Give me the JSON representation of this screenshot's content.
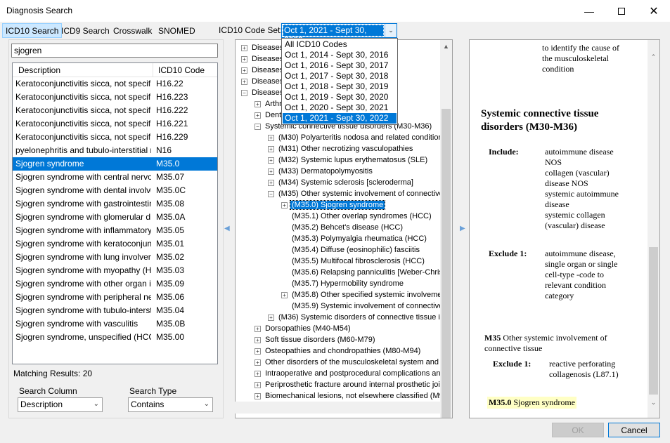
{
  "window": {
    "title": "Diagnosis Search"
  },
  "tabs": [
    "ICD10 Search",
    "ICD9 Search",
    "Crosswalk",
    "SNOMED"
  ],
  "codeset": {
    "label": "ICD10 Code Set:",
    "selected": "Oct 1, 2021 - Sept 30, 2022",
    "options": [
      "All ICD10 Codes",
      "Oct 1, 2014 - Sept 30, 2016",
      "Oct 1, 2016 - Sept 30, 2017",
      "Oct 1, 2017 - Sept 30, 2018",
      "Oct 1, 2018 - Sept 30, 2019",
      "Oct 1, 2019 - Sept 30, 2020",
      "Oct 1, 2020 - Sept 30, 2021",
      "Oct 1, 2021 - Sept 30, 2022"
    ]
  },
  "search": {
    "value": "sjogren"
  },
  "results": {
    "columns": [
      "Description",
      "ICD10 Code"
    ],
    "rows": [
      [
        "Keratoconjunctivitis sicca, not specifie...",
        "H16.22"
      ],
      [
        "Keratoconjunctivitis sicca, not specifie...",
        "H16.223"
      ],
      [
        "Keratoconjunctivitis sicca, not specifie...",
        "H16.222"
      ],
      [
        "Keratoconjunctivitis sicca, not specifie...",
        "H16.221"
      ],
      [
        "Keratoconjunctivitis sicca, not specifie...",
        "H16.229"
      ],
      [
        "pyelonephritis and tubulo-interstitial nep...",
        "N16"
      ],
      [
        "Sjogren syndrome",
        "M35.0"
      ],
      [
        "Sjogren syndrome with central nervous ...",
        "M35.07"
      ],
      [
        "Sjogren syndrome with dental involveme...",
        "M35.0C"
      ],
      [
        "Sjogren syndrome with gastrointestinal i...",
        "M35.08"
      ],
      [
        "Sjogren syndrome with glomerular disea...",
        "M35.0A"
      ],
      [
        "Sjogren syndrome with inflammatory art...",
        "M35.05"
      ],
      [
        "Sjogren syndrome with keratoconjuncti...",
        "M35.01"
      ],
      [
        "Sjogren syndrome with lung involveme...",
        "M35.02"
      ],
      [
        "Sjogren syndrome with myopathy (HCC)",
        "M35.03"
      ],
      [
        "Sjogren syndrome with other organ inv...",
        "M35.09"
      ],
      [
        "Sjogren syndrome with peripheral nervo...",
        "M35.06"
      ],
      [
        "Sjogren syndrome with tubulo-interstiti...",
        "M35.04"
      ],
      [
        "Sjogren syndrome with vasculitis",
        "M35.0B"
      ],
      [
        "Sjogren syndrome, unspecified (HCC)",
        "M35.00"
      ]
    ],
    "selected_index": 6,
    "matching_label": "Matching Results: 20"
  },
  "search_column": {
    "label": "Search Column",
    "value": "Description"
  },
  "search_type": {
    "label": "Search Type",
    "value": "Contains"
  },
  "tree": [
    {
      "text": "Diseases",
      "level": 0,
      "exp": "+"
    },
    {
      "text": "Diseases",
      "level": 0,
      "exp": "+"
    },
    {
      "text": "Diseases",
      "level": 0,
      "exp": "+"
    },
    {
      "text": "Diseases                                                    ue (L00-L99)",
      "level": 0,
      "exp": "+"
    },
    {
      "text": "Diseases                                                    connective t",
      "level": 0,
      "exp": "-"
    },
    {
      "text": "Arthr",
      "level": 1,
      "exp": "+"
    },
    {
      "text": "Dent                                              lusion] and ot",
      "level": 1,
      "exp": "+"
    },
    {
      "text": "Systemic connective tissue disorders (M30-M36)",
      "level": 1,
      "exp": "-"
    },
    {
      "text": "(M30) Polyarteritis nodosa and related conditions",
      "level": 2,
      "exp": "+"
    },
    {
      "text": "(M31) Other necrotizing vasculopathies",
      "level": 2,
      "exp": "+"
    },
    {
      "text": "(M32) Systemic lupus erythematosus (SLE)",
      "level": 2,
      "exp": "+"
    },
    {
      "text": "(M33) Dermatopolymyositis",
      "level": 2,
      "exp": "+"
    },
    {
      "text": "(M34) Systemic sclerosis [scleroderma]",
      "level": 2,
      "exp": "+"
    },
    {
      "text": "(M35) Other systemic involvement of connective t",
      "level": 2,
      "exp": "-"
    },
    {
      "text": "(M35.0) Sjogren syndrome",
      "level": 3,
      "exp": "+",
      "sel": true
    },
    {
      "text": "(M35.1) Other overlap syndromes (HCC)",
      "level": 3,
      "exp": ""
    },
    {
      "text": "(M35.2) Behcet's disease (HCC)",
      "level": 3,
      "exp": ""
    },
    {
      "text": "(M35.3) Polymyalgia rheumatica (HCC)",
      "level": 3,
      "exp": ""
    },
    {
      "text": "(M35.4) Diffuse (eosinophilic) fasciitis",
      "level": 3,
      "exp": ""
    },
    {
      "text": "(M35.5) Multifocal fibrosclerosis (HCC)",
      "level": 3,
      "exp": ""
    },
    {
      "text": "(M35.6) Relapsing panniculitis [Weber-Christia",
      "level": 3,
      "exp": ""
    },
    {
      "text": "(M35.7) Hypermobility syndrome",
      "level": 3,
      "exp": ""
    },
    {
      "text": "(M35.8) Other specified systemic involvement",
      "level": 3,
      "exp": "+"
    },
    {
      "text": "(M35.9) Systemic involvement of connective",
      "level": 3,
      "exp": ""
    },
    {
      "text": "(M36) Systemic disorders of connective tissue in d",
      "level": 2,
      "exp": "+"
    },
    {
      "text": "Dorsopathies (M40-M54)",
      "level": 1,
      "exp": "+"
    },
    {
      "text": "Soft tissue disorders (M60-M79)",
      "level": 1,
      "exp": "+"
    },
    {
      "text": "Osteopathies and chondropathies (M80-M94)",
      "level": 1,
      "exp": "+"
    },
    {
      "text": "Other disorders of the musculoskeletal system and co",
      "level": 1,
      "exp": "+"
    },
    {
      "text": "Intraoperative and postprocedural complications and",
      "level": 1,
      "exp": "+"
    },
    {
      "text": "Periprosthetic fracture around internal prosthetic joint",
      "level": 1,
      "exp": "+"
    },
    {
      "text": "Biomechanical lesions, not elsewhere classified (M99",
      "level": 1,
      "exp": "+"
    }
  ],
  "detail": {
    "top_lines": [
      "to identify the cause of",
      "the musculoskeletal",
      "condition"
    ],
    "section_title_1": "Systemic connective tissue",
    "section_title_2": "disorders (M30-M36)",
    "include_label": "Include:",
    "include_lines": [
      "autoimmune disease",
      "NOS",
      "collagen (vascular)",
      "disease NOS",
      "systemic autoimmune",
      "disease",
      "systemic collagen",
      "(vascular) disease"
    ],
    "exclude1_label": "Exclude 1:",
    "exclude1_lines": [
      "autoimmune disease,",
      "single organ or single",
      "cell-type -code to",
      "relevant condition",
      "category"
    ],
    "m35_code": "M35",
    "m35_title_1": "Other systemic involvement of",
    "m35_title_2": "connective tissue",
    "m35_exclude_label": "Exclude 1:",
    "m35_exclude_lines": [
      "reactive perforating",
      "collagenosis (L87.1)"
    ],
    "m350_code": "M35.0",
    "m350_title": "Sjogren syndrome"
  },
  "buttons": {
    "ok": "OK",
    "cancel": "Cancel"
  }
}
